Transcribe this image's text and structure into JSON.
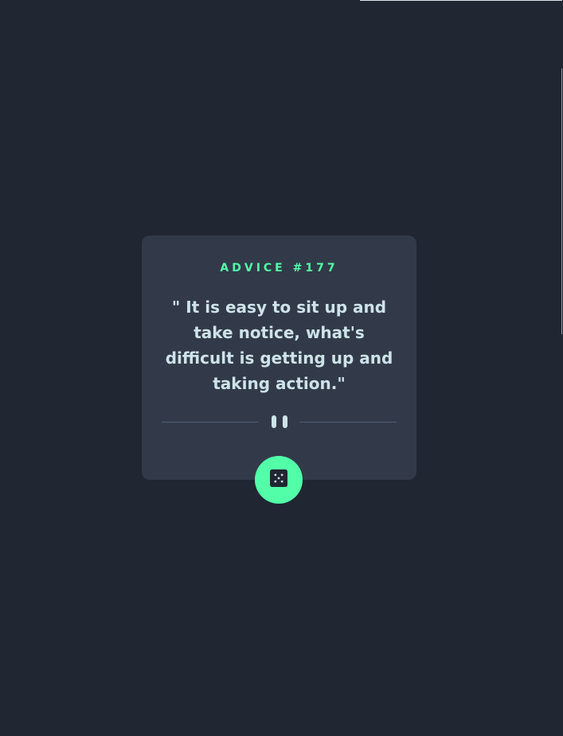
{
  "advice": {
    "label": "ADVICE #177",
    "quote": "\" It is easy to sit up and take notice, what's difficult is getting up and taking action.\""
  },
  "icons": {
    "divider": "pause-icon",
    "button": "dice-icon"
  },
  "colors": {
    "background": "#202632",
    "card": "#323a49",
    "accent": "#52ffa8",
    "text": "#cee3e9",
    "divider_line": "#4f5d74"
  }
}
